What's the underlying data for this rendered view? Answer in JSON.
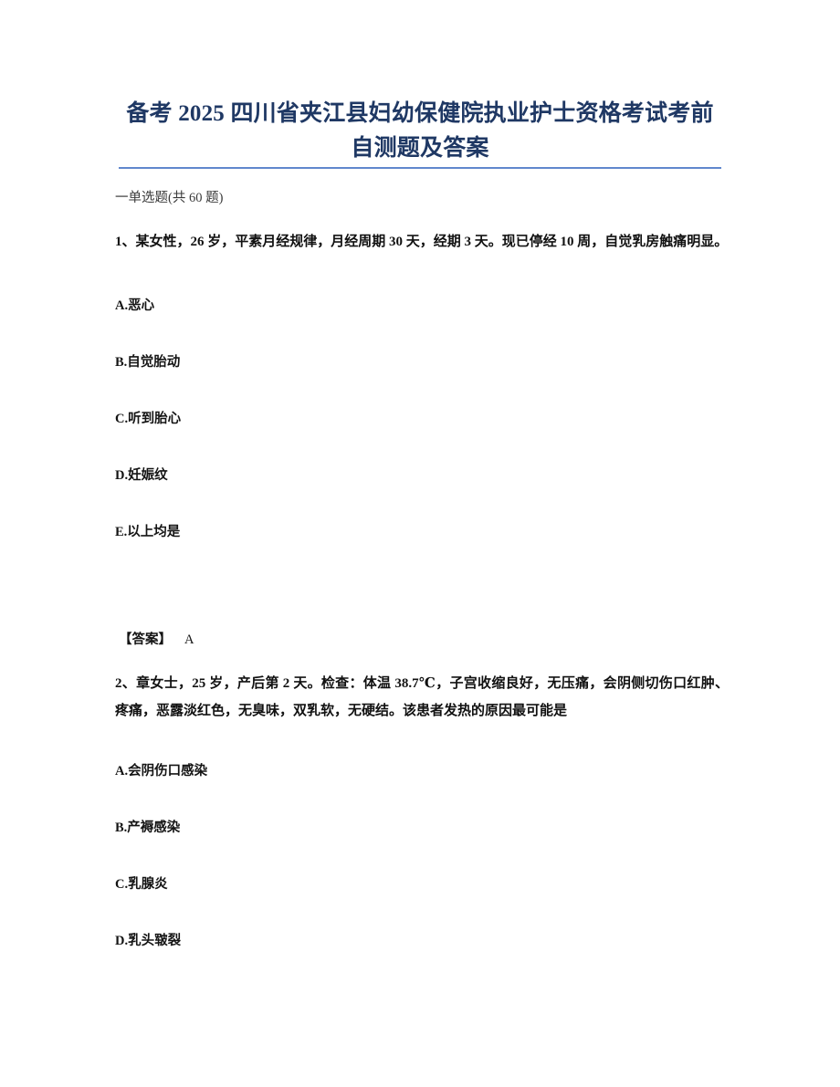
{
  "document": {
    "title_line_1": "备考 2025 四川省夹江县妇幼保健院执业护士资格考试考前",
    "title_line_2": "自测题及答案",
    "title_color": "#1f3864",
    "rule_color": "#4472c4",
    "section_heading": "一单选题(共 60 题)"
  },
  "questions": [
    {
      "number": "1",
      "stem": "1、某女性，26 岁，平素月经规律，月经周期 30 天，经期 3 天。现已停经 10 周，自觉乳房触痛明显。",
      "options": [
        {
          "key": "A",
          "text": "A.恶心"
        },
        {
          "key": "B",
          "text": "B.自觉胎动"
        },
        {
          "key": "C",
          "text": "C.听到胎心"
        },
        {
          "key": "D",
          "text": "D.妊娠纹"
        },
        {
          "key": "E",
          "text": "E.以上均是"
        }
      ],
      "answer_label": "【答案】",
      "answer_value": "A"
    },
    {
      "number": "2",
      "stem": "2、章女士，25 岁，产后第 2 天。检查：体温 38.7℃，子宫收缩良好，无压痛，会阴侧切伤口红肿、疼痛，恶露淡红色，无臭味，双乳软，无硬结。该患者发热的原因最可能是",
      "options": [
        {
          "key": "A",
          "text": "A.会阴伤口感染"
        },
        {
          "key": "B",
          "text": "B.产褥感染"
        },
        {
          "key": "C",
          "text": "C.乳腺炎"
        },
        {
          "key": "D",
          "text": "D.乳头皲裂"
        }
      ]
    }
  ]
}
